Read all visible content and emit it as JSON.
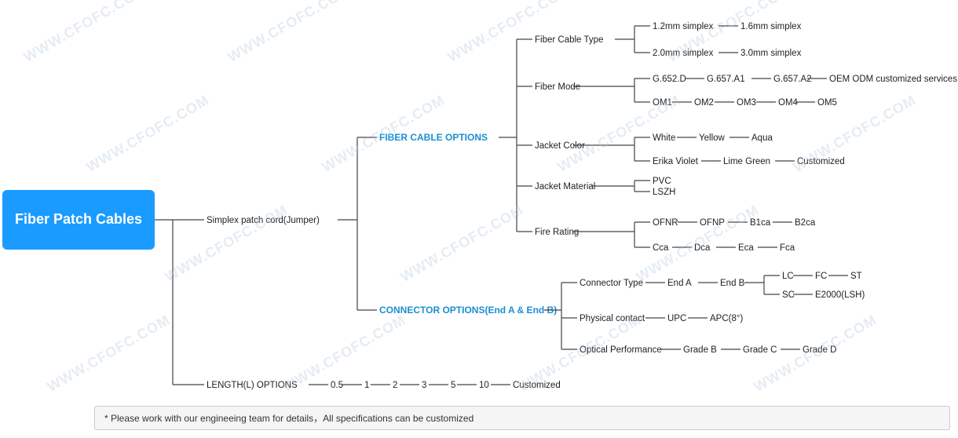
{
  "title": "Fiber Patch Cables",
  "note": "* Please work with our engineeing team for details，All specifications can be customized",
  "watermark_text": "WWW.CFOFC.COM",
  "tree": {
    "root": "Fiber Patch Cables",
    "level1": [
      {
        "label": "Simplex patch cord(Jumper)"
      },
      {
        "label": "LENGTH(L) OPTIONS"
      }
    ],
    "fiber_cable_options": "FIBER CABLE OPTIONS",
    "connector_options": "CONNECTOR OPTIONS(End A & End B)"
  }
}
